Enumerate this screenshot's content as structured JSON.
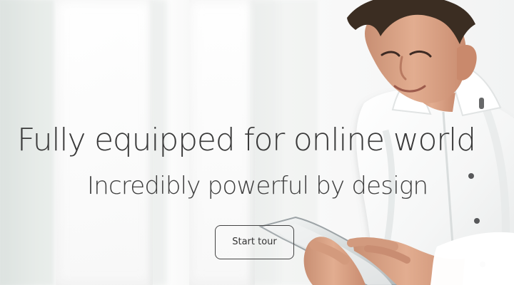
{
  "hero": {
    "headline": "Fully equipped for online world",
    "subheadline": "Incredibly powerful by design",
    "button_label": "Start tour"
  },
  "illustration": {
    "subject": "man using tablet",
    "shirt_color": "#ffffff",
    "tablet_color": "#dadfe0",
    "skin_color": "#d8a182",
    "hair_color": "#3b2d22"
  }
}
